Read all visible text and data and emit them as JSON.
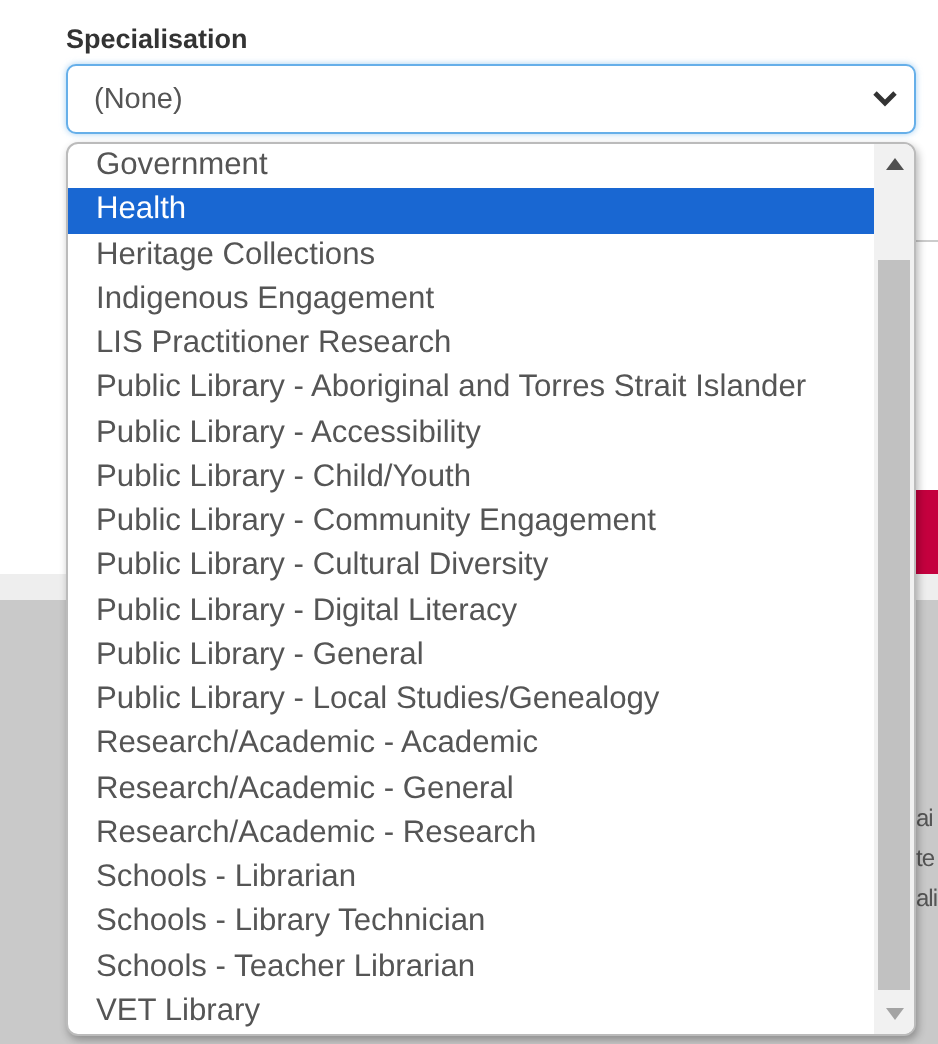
{
  "field": {
    "label": "Specialisation",
    "value": "(None)"
  },
  "options": [
    {
      "label": "Government",
      "selected": false
    },
    {
      "label": "Health",
      "selected": true
    },
    {
      "label": "Heritage Collections",
      "selected": false
    },
    {
      "label": "Indigenous Engagement",
      "selected": false
    },
    {
      "label": "LIS Practitioner Research",
      "selected": false
    },
    {
      "label": "Public Library - Aboriginal and Torres Strait Islander",
      "selected": false
    },
    {
      "label": "Public Library - Accessibility",
      "selected": false
    },
    {
      "label": "Public Library - Child/Youth",
      "selected": false
    },
    {
      "label": "Public Library - Community Engagement",
      "selected": false
    },
    {
      "label": "Public Library - Cultural Diversity",
      "selected": false
    },
    {
      "label": "Public Library - Digital Literacy",
      "selected": false
    },
    {
      "label": "Public Library - General",
      "selected": false
    },
    {
      "label": "Public Library - Local Studies/Genealogy",
      "selected": false
    },
    {
      "label": "Research/Academic - Academic",
      "selected": false
    },
    {
      "label": "Research/Academic - General",
      "selected": false
    },
    {
      "label": "Research/Academic - Research",
      "selected": false
    },
    {
      "label": "Schools - Librarian",
      "selected": false
    },
    {
      "label": "Schools - Library Technician",
      "selected": false
    },
    {
      "label": "Schools - Teacher Librarian",
      "selected": false
    },
    {
      "label": "VET Library",
      "selected": false
    }
  ],
  "background_fragments": [
    "ai",
    "te",
    "ali"
  ]
}
